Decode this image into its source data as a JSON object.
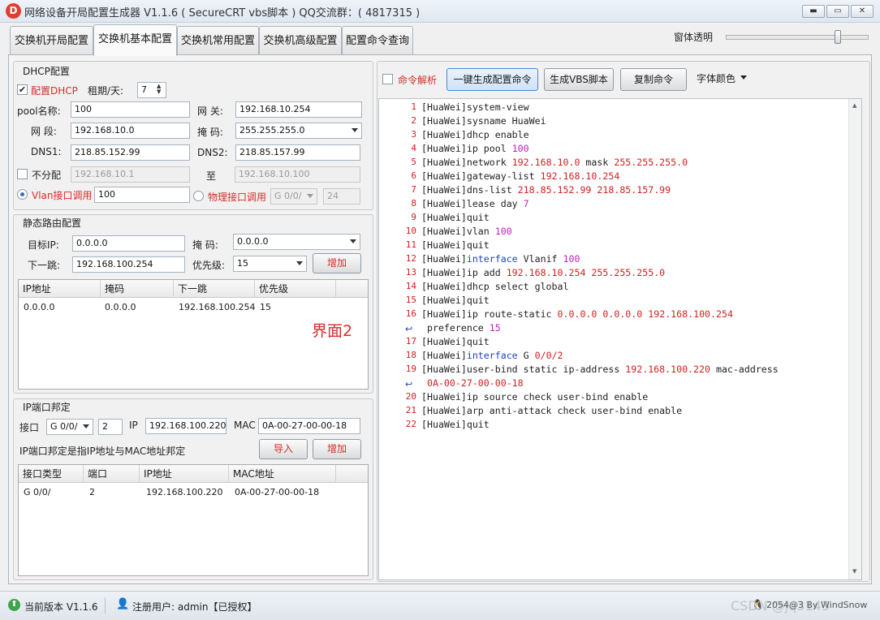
{
  "window": {
    "title": "网络设备开局配置生成器  V1.1.6 ( SecureCRT vbs脚本 )  QQ交流群：( 4817315 )",
    "icon_letter": "D",
    "minimize": "▬",
    "maximize": "▭",
    "close": "✕"
  },
  "tabs": [
    "交换机开局配置",
    "交换机基本配置",
    "交换机常用配置",
    "交换机高级配置",
    "配置命令查询"
  ],
  "transparency_label": "窗体透明",
  "transparency_level": 0.8,
  "dhcp": {
    "group_title": "DHCP配置",
    "enable_label": "配置DHCP",
    "enable_checked": true,
    "lease_label": "租期/天:",
    "lease_value": "7",
    "pool_label": "pool名称:",
    "pool_value": "100",
    "gateway_label": "网 关:",
    "gateway_value": "192.168.10.254",
    "segment_label": "网 段:",
    "segment_value": "192.168.10.0",
    "mask_label": "掩 码:",
    "mask_value": "255.255.255.0",
    "dns1_label": "DNS1:",
    "dns1_value": "218.85.152.99",
    "dns2_label": "DNS2:",
    "dns2_value": "218.85.157.99",
    "exclude_label": "不分配",
    "exclude_from": "192.168.10.1",
    "to_label": "至",
    "exclude_to": "192.168.10.100",
    "vlan_radio_label": "Vlan接口调用",
    "vlan_value": "100",
    "phys_radio_label": "物理接口调用",
    "phys_if": "G 0/0/",
    "phys_port": "24"
  },
  "static_route": {
    "group_title": "静态路由配置",
    "dest_label": "目标IP:",
    "dest_value": "0.0.0.0",
    "mask_label": "掩 码:",
    "mask_value": "0.0.0.0",
    "nexthop_label": "下一跳:",
    "nexthop_value": "192.168.100.254",
    "priority_label": "优先级:",
    "priority_value": "15",
    "add_button": "增加",
    "columns": [
      "IP地址",
      "掩码",
      "下一跳",
      "优先级"
    ],
    "rows": [
      [
        "0.0.0.0",
        "0.0.0.0",
        "192.168.100.254",
        "15"
      ]
    ],
    "annotation": "界面2"
  },
  "ip_bind": {
    "group_title": "IP端口邦定",
    "port_label": "接口",
    "port_type": "G 0/0/",
    "port_num": "2",
    "ip_label": "IP",
    "ip_value": "192.168.100.220",
    "mac_label": "MAC",
    "mac_value": "0A-00-27-00-00-18",
    "note": "IP端口邦定是指IP地址与MAC地址邦定",
    "import_button": "导入",
    "add_button": "增加",
    "columns": [
      "接口类型",
      "端口",
      "IP地址",
      "MAC地址"
    ],
    "rows": [
      [
        "G 0/0/",
        "2",
        "192.168.100.220",
        "0A-00-27-00-00-18"
      ]
    ]
  },
  "toolbar": {
    "parse_label": "命令解析",
    "generate_button": "一键生成配置命令",
    "vbs_button": "生成VBS脚本",
    "copy_button": "复制命令",
    "font_color_label": "字体颜色"
  },
  "code_lines": [
    {
      "num": "1",
      "text": "[HuaWei]system-view"
    },
    {
      "num": "2",
      "text": "[HuaWei]sysname HuaWei"
    },
    {
      "num": "3",
      "text": "[HuaWei]dhcp enable"
    },
    {
      "num": "4",
      "text": "[HuaWei]ip pool 100"
    },
    {
      "num": "5",
      "text": "[HuaWei]network 192.168.10.0 mask 255.255.255.0"
    },
    {
      "num": "6",
      "text": "[HuaWei]gateway-list 192.168.10.254"
    },
    {
      "num": "7",
      "text": "[HuaWei]dns-list 218.85.152.99 218.85.157.99"
    },
    {
      "num": "8",
      "text": "[HuaWei]lease day 7"
    },
    {
      "num": "9",
      "text": "[HuaWei]quit"
    },
    {
      "num": "10",
      "text": "[HuaWei]vlan 100"
    },
    {
      "num": "11",
      "text": "[HuaWei]quit"
    },
    {
      "num": "12",
      "text": "[HuaWei]interface Vlanif 100"
    },
    {
      "num": "13",
      "text": "[HuaWei]ip add 192.168.10.254 255.255.255.0"
    },
    {
      "num": "14",
      "text": "[HuaWei]dhcp select global"
    },
    {
      "num": "15",
      "text": "[HuaWei]quit"
    },
    {
      "num": "16",
      "text": "[HuaWei]ip route-static 0.0.0.0 0.0.0.0 192.168.100.254"
    },
    {
      "num": "",
      "text": " preference 15"
    },
    {
      "num": "17",
      "text": "[HuaWei]quit"
    },
    {
      "num": "18",
      "text": "[HuaWei]interface G 0/0/2"
    },
    {
      "num": "19",
      "text": "[HuaWei]user-bind static ip-address 192.168.100.220 mac-address"
    },
    {
      "num": "",
      "text": " 0A-00-27-00-00-18"
    },
    {
      "num": "20",
      "text": "[HuaWei]ip source check user-bind enable"
    },
    {
      "num": "21",
      "text": "[HuaWei]arp anti-attack check user-bind enable"
    },
    {
      "num": "22",
      "text": "[HuaWei]quit"
    }
  ],
  "status": {
    "version": "当前版本 V1.1.6",
    "user": "注册用户: admin【已授权】",
    "right": "2054@3 By WindSnow",
    "watermark": "CSDN @jq3143"
  }
}
